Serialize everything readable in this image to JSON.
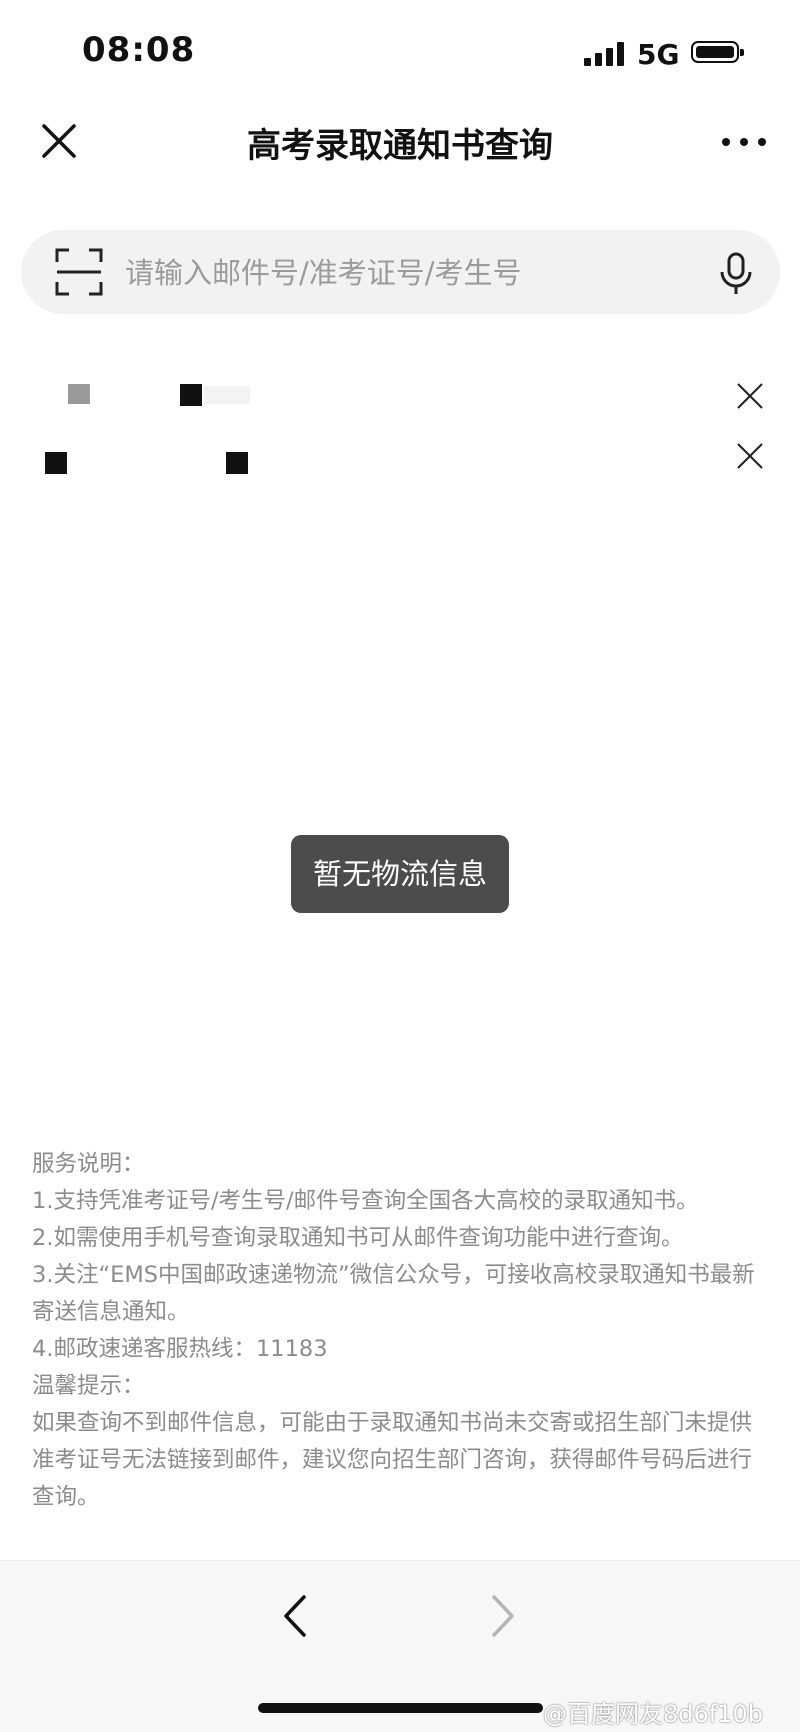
{
  "status_bar": {
    "time": "08:08",
    "network": "5G",
    "icons": [
      "signal-icon",
      "battery-icon"
    ]
  },
  "nav": {
    "title": "高考录取通知书查询",
    "icons": [
      "close-icon",
      "more-icon"
    ]
  },
  "search": {
    "placeholder": "请输入邮件号/准考证号/考生号",
    "value": "",
    "icons": [
      "scan-icon",
      "microphone-icon"
    ]
  },
  "history": {
    "items": [
      {
        "label": "",
        "note": "redacted entry"
      },
      {
        "label": "",
        "note": "redacted entry"
      }
    ],
    "delete_icon": "close-icon"
  },
  "toast": {
    "message": "暂无物流信息"
  },
  "service_info": {
    "heading": "服务说明：",
    "lines": [
      "1.支持凭准考证号/考生号/邮件号查询全国各大高校的录取通知书。",
      "2.如需使用手机号查询录取通知书可从邮件查询功能中进行查询。",
      "3.关注“EMS中国邮政速递物流”微信公众号，可接收高校录取通知书最新寄送信息通知。",
      "4.邮政速递客服热线：11183"
    ],
    "tips_heading": "温馨提示：",
    "tips_text": "如果查询不到邮件信息，可能由于录取通知书尚未交寄或招生部门未提供准考证号无法链接到邮件，建议您向招生部门咨询，获得邮件号码后进行查询。"
  },
  "bottom_nav": {
    "icons": [
      "back-arrow-icon",
      "forward-arrow-icon"
    ]
  },
  "watermark": {
    "text": "@百度网友8d6f10b"
  },
  "colors": {
    "toast_bg": "#4c4c4c",
    "search_bg": "#f2f2f2",
    "muted_text": "#8c8c8c",
    "disabled_arrow": "#b5b5b5"
  }
}
